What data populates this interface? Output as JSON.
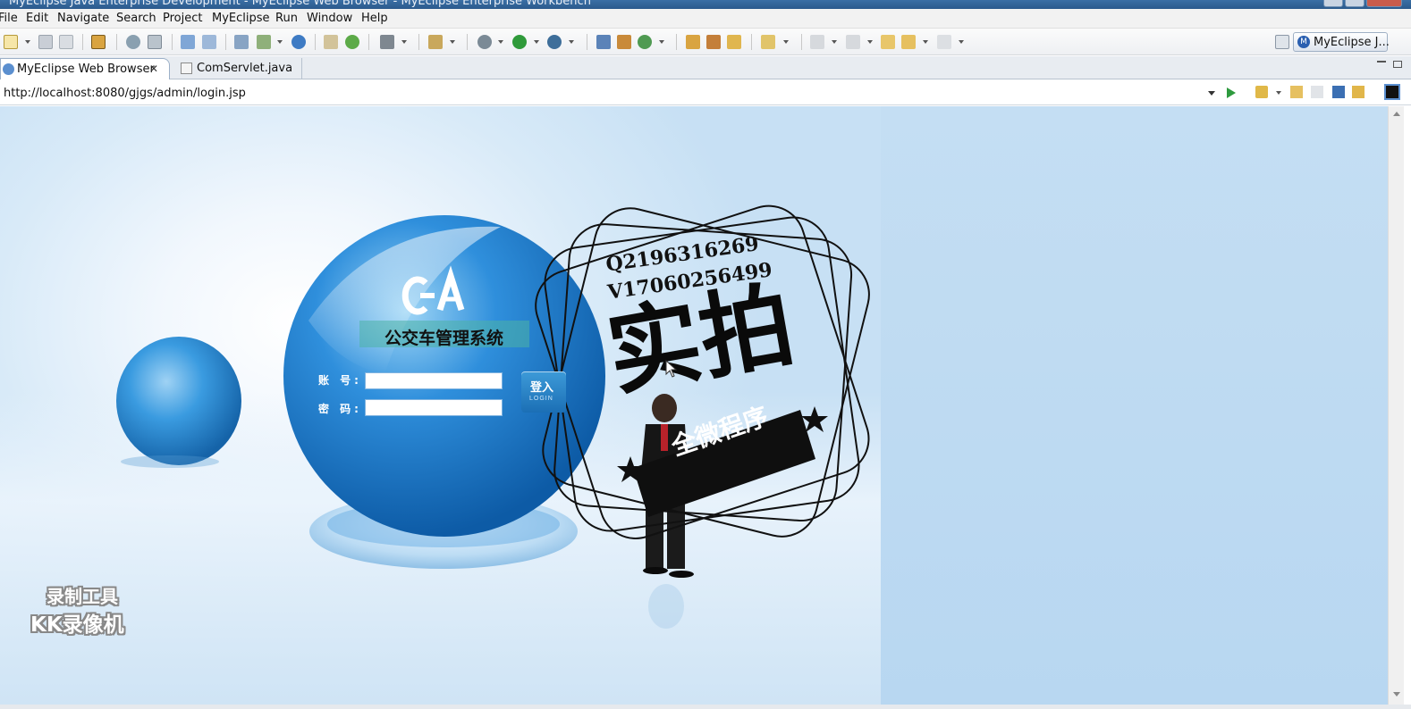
{
  "window": {
    "title": "MyEclipse Java Enterprise Development - MyEclipse Web Browser - MyEclipse Enterprise Workbench"
  },
  "menu": {
    "items": [
      "File",
      "Edit",
      "Navigate",
      "Search",
      "Project",
      "MyEclipse",
      "Run",
      "Window",
      "Help"
    ]
  },
  "toolbar": {
    "perspective_label": "MyEclipse J...",
    "icons": [
      "new-icon",
      "save-icon",
      "print-icon",
      "package-icon",
      "debug-icon",
      "server-icon",
      "deploy-icon",
      "run-icon",
      "globe-icon",
      "open-type-icon",
      "search-icon",
      "back-icon",
      "forward-icon"
    ]
  },
  "tabs": [
    {
      "label": "MyEclipse Web Browser",
      "active": true
    },
    {
      "label": "ComServlet.java",
      "active": false
    }
  ],
  "browser": {
    "url": "http://localhost:8080/gjgs/admin/login.jsp"
  },
  "login_page": {
    "logo_text": "EA",
    "system_title": "公交车管理系统",
    "account_label": "账  号:",
    "password_label": "密  码:",
    "account_value": "",
    "password_value": "",
    "login_button": "登入",
    "login_button_sub": "LOGIN"
  },
  "watermark": {
    "qq": "Q2196316269",
    "wechat": "V17060256499",
    "big_text": "实拍",
    "ribbon_text": "全微程序"
  },
  "recorder": {
    "line1": "录制工具",
    "line2": "KK录像机"
  },
  "colors": {
    "sky_blue": "#b8d7f1",
    "sphere_blue": "#1f7fd0",
    "titlebar": "#2b5a8c"
  }
}
